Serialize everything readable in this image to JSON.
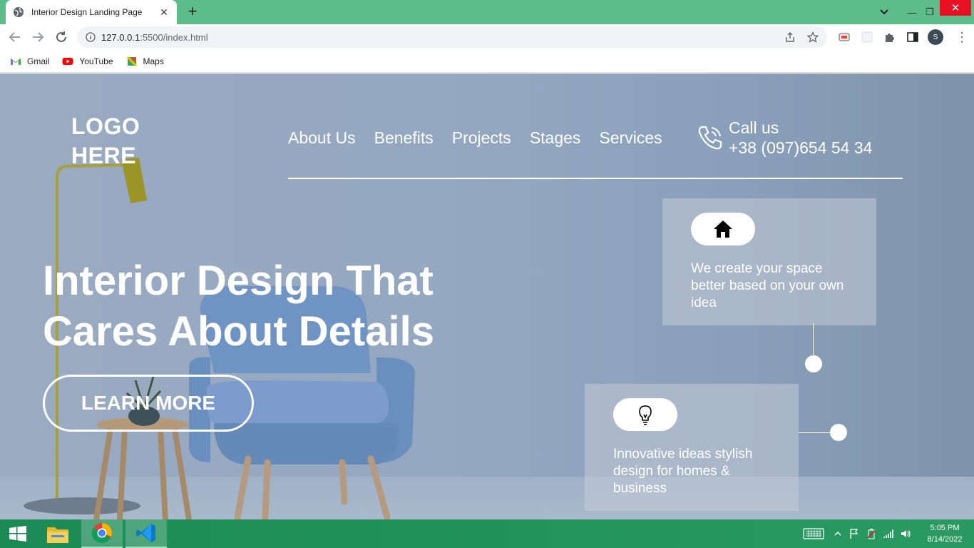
{
  "browser": {
    "tab_title": "Interior Design Landing Page",
    "url_host": "127.0.0.1",
    "url_rest": ":5500/index.html",
    "profile_initial": "S",
    "bookmarks": [
      {
        "label": "Gmail",
        "icon": "gmail-icon"
      },
      {
        "label": "YouTube",
        "icon": "youtube-icon"
      },
      {
        "label": "Maps",
        "icon": "maps-icon"
      }
    ]
  },
  "site": {
    "logo_line1": "LOGO",
    "logo_line2": "HERE",
    "nav": [
      "About Us",
      "Benefits",
      "Projects",
      "Stages",
      "Services"
    ],
    "call_label": "Call us",
    "phone": "+38 (097)654 54 34",
    "hero_line1": "Interior Design That",
    "hero_line2": "Cares About Details",
    "cta": "LEARN MORE",
    "cards": [
      {
        "icon": "house-icon",
        "text": "We create your space better based on your own idea"
      },
      {
        "icon": "lightbulb-icon",
        "text": "Innovative ideas stylish design for homes & business"
      }
    ]
  },
  "taskbar": {
    "time": "5:05 PM",
    "date": "8/14/2022"
  },
  "colors": {
    "tab_strip": "#5dbd8a",
    "page_bg": "#94a8c1",
    "taskbar": "#1c8a55",
    "close_button": "#e81123"
  }
}
